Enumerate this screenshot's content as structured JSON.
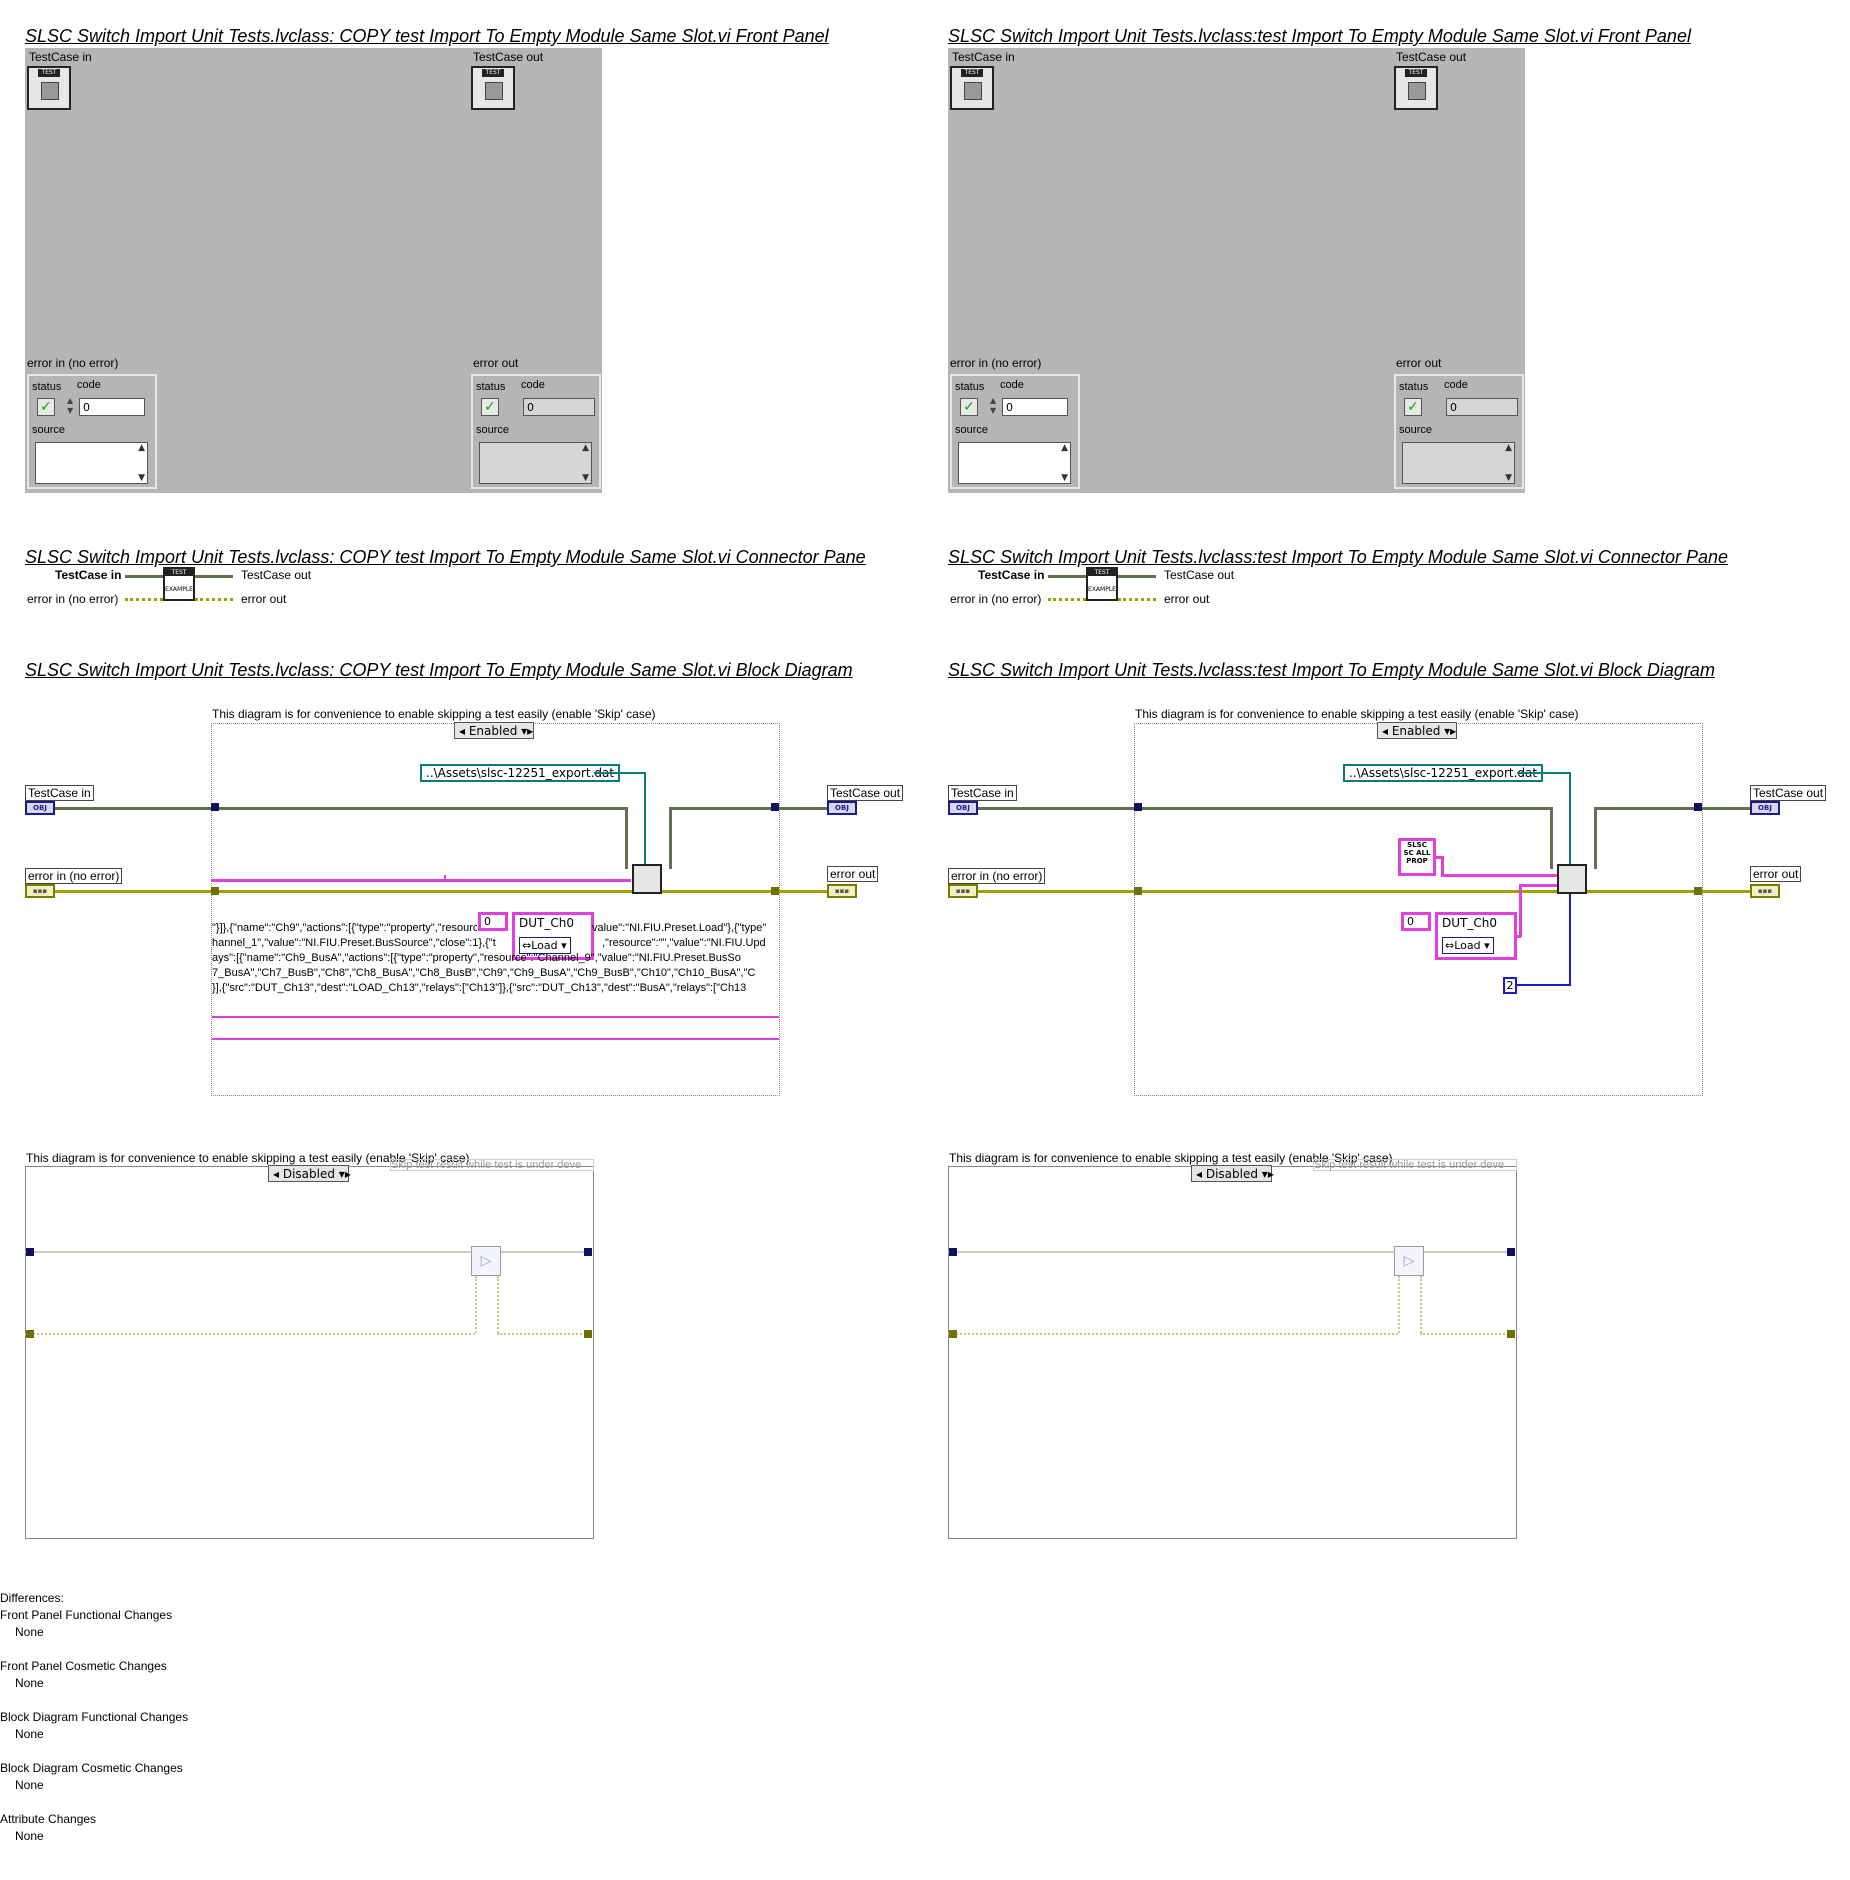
{
  "left": {
    "fp_title": "SLSC Switch Import Unit Tests.lvclass:  COPY  test Import To Empty Module Same Slot.vi Front Panel",
    "cp_title": "SLSC Switch Import Unit Tests.lvclass:  COPY  test Import To Empty Module Same Slot.vi Connector Pane",
    "bd_title": "SLSC Switch Import Unit Tests.lvclass:  COPY  test Import To Empty Module Same Slot.vi Block Diagram"
  },
  "right": {
    "fp_title": "SLSC Switch Import Unit Tests.lvclass:test Import To Empty Module Same Slot.vi Front Panel",
    "cp_title": "SLSC Switch Import Unit Tests.lvclass:test Import To Empty Module Same Slot.vi Connector Pane",
    "bd_title": "SLSC Switch Import Unit Tests.lvclass:test Import To Empty Module Same Slot.vi Block Diagram"
  },
  "controls": {
    "testcase_in": "TestCase in",
    "testcase_out": "TestCase out",
    "error_in": "error in (no error)",
    "error_out": "error out",
    "status": "status",
    "code": "code",
    "source": "source",
    "code_value": "0"
  },
  "connector": {
    "testcase_in": "TestCase in",
    "testcase_out": "TestCase out",
    "error_in": "error in (no error)",
    "error_out": "error out",
    "icon_top": "TEST",
    "icon_bottom": "EXAMPLE"
  },
  "diagram": {
    "frame_comment": "This diagram is for convenience to enable skipping a test easily (enable 'Skip' case)",
    "case_enabled": "Enabled",
    "case_disabled": "Disabled",
    "path_const": "..\\Assets\\slsc-12251_export.dat",
    "num_zero": "0",
    "channel": "DUT_Ch0",
    "action": "Load",
    "num_two": "2",
    "skip_comment": "Skip test result while test is under deve",
    "obj_tag": "OBJ",
    "json_lines": [
      "\"}]},{\"name\":\"Ch9\",\"actions\":[{\"type\":\"property\",\"resource\":\"\",\"value\":\"NI.FIU.Preset.Load\"},{\"type\"",
      "hannel_1\",\"value\":\"NI.FIU.Preset.BusSource\",\"close\":1},{\"t",
      "ays\":[{\"name\":\"Ch9_BusA\",\"actions\":[{\"type\":\"property\",\"resource\":\"Channel_9\",\"value\":\"NI.FIU.Preset.BusSo",
      "7_BusA\",\"Ch7_BusB\",\"Ch8\",\"Ch8_BusA\",\"Ch8_BusB\",\"Ch9\",\"Ch9_BusA\",\"Ch9_BusB\",\"Ch10\",\"Ch10_BusA\",\"C",
      "}],{\"src\":\"DUT_Ch13\",\"dest\":\"LOAD_Ch13\",\"relays\":[\"Ch13\"]},{\"src\":\"DUT_Ch13\",\"dest\":\"BusA\",\"relays\":[\"Ch13"
    ],
    "json_line2_suffix": ",\"resource\":\"\",\"value\":\"NI.FIU.Upd",
    "slsc_const": "SLSC SC ALL PROP"
  },
  "differences": {
    "heading": "Differences:",
    "items": [
      {
        "title": "Front Panel Functional Changes",
        "value": "None"
      },
      {
        "title": "Front Panel Cosmetic Changes",
        "value": "None"
      },
      {
        "title": "Block Diagram Functional Changes",
        "value": "None"
      },
      {
        "title": "Block Diagram Cosmetic Changes",
        "value": "None"
      },
      {
        "title": "Attribute Changes",
        "value": "None"
      }
    ]
  }
}
